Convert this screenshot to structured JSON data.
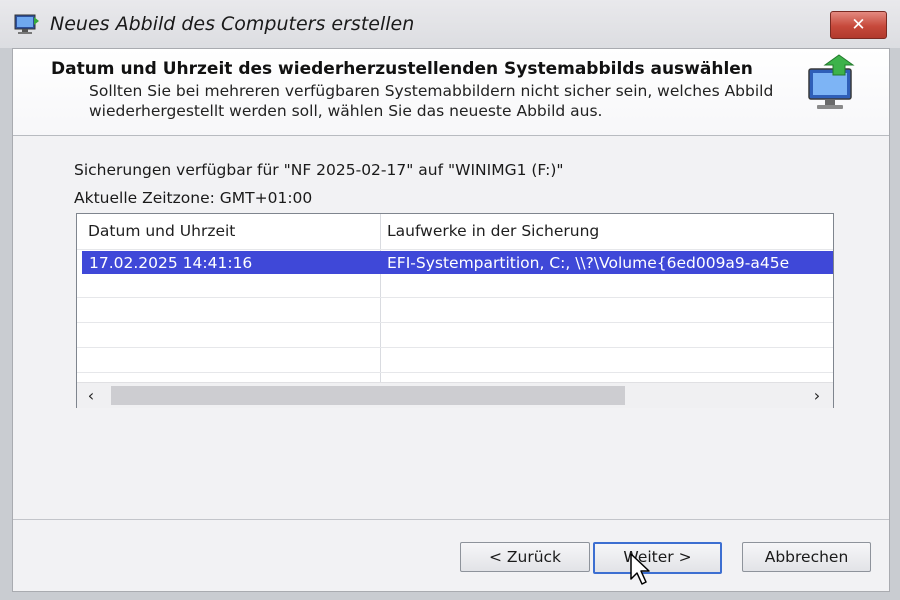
{
  "window": {
    "title": "Neues Abbild des Computers erstellen",
    "close_label": "✕"
  },
  "header": {
    "title": "Datum und Uhrzeit des wiederherzustellenden Systemabbilds auswählen",
    "description": "Sollten Sie bei mehreren verfügbaren Systemabbildern nicht sicher sein, welches Abbild wiederhergestellt werden soll, wählen Sie das neueste Abbild aus."
  },
  "info": {
    "backups_available": "Sicherungen verfügbar für \"NF 2025-02-17\" auf \"WINIMG1 (F:)\"",
    "timezone": "Aktuelle Zeitzone: GMT+01:00"
  },
  "table": {
    "columns": [
      "Datum und Uhrzeit",
      "Laufwerke in der Sicherung"
    ],
    "rows": [
      {
        "datetime": "17.02.2025 14:41:16",
        "drives": "EFI-Systempartition, C:, \\\\?\\Volume{6ed009a9-a45e",
        "selected": true
      }
    ],
    "scroll_left": "‹",
    "scroll_right": "›"
  },
  "buttons": {
    "back": "< Zurück",
    "next": "Weiter >",
    "cancel": "Abbrechen"
  },
  "colors": {
    "selection": "#3f48d8",
    "close_button": "#c6493b",
    "default_button_border": "#3d6fd1"
  },
  "icons": [
    "computer-icon",
    "restore-arrow-icon",
    "close-icon",
    "mouse-cursor-icon"
  ]
}
